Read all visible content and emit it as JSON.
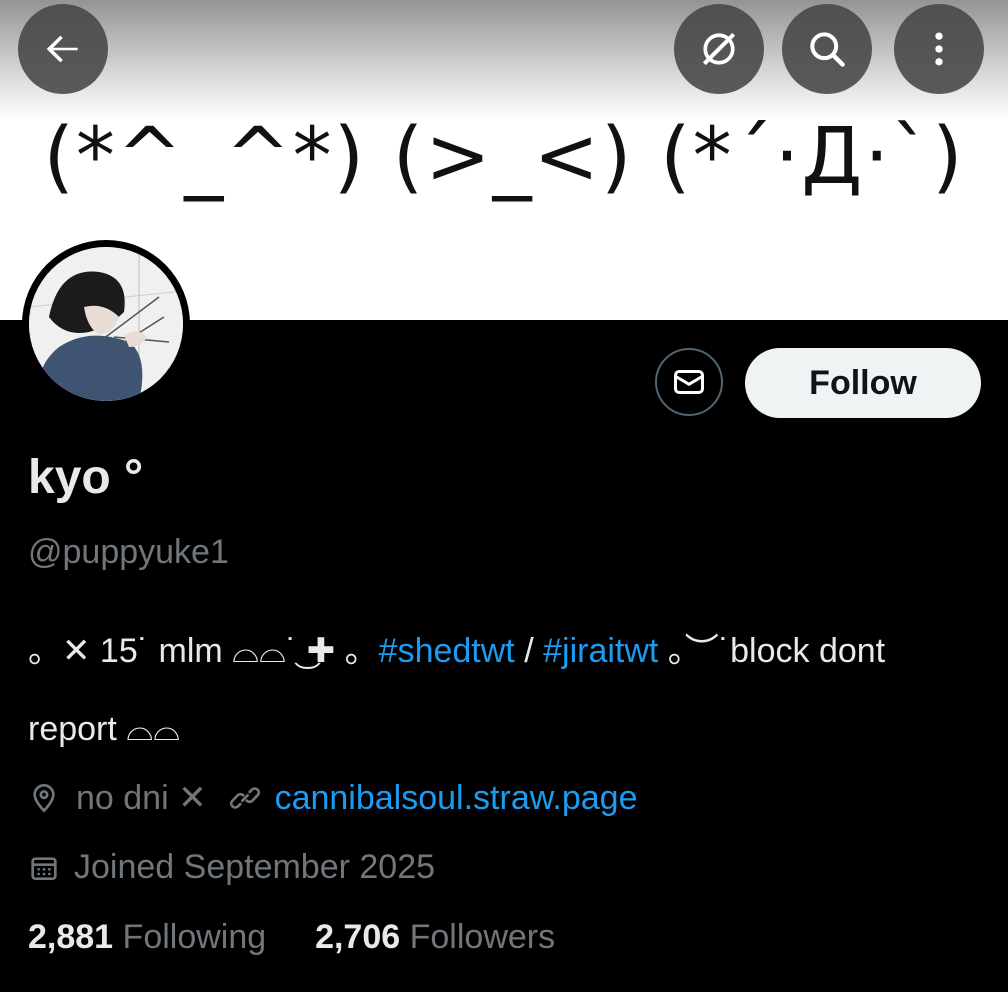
{
  "banner": {
    "text": "(*^_^*) (>_<) (*´·Д·`)"
  },
  "top_bar": {
    "back_icon": "arrow-left-icon",
    "grok_icon": "grok-icon",
    "search_icon": "search-icon",
    "more_icon": "more-vertical-icon"
  },
  "profile": {
    "display_name": "kyo °",
    "handle": "@puppyuke1",
    "follow_label": "Follow",
    "bio": {
      "part1": "。✕ 15˙ mlm ⌓⌓˙͜ ✚ 。",
      "hashtag1": "#shedtwt",
      "sep": " / ",
      "hashtag2": "#jiraitwt",
      "part2": " 。︶˙block dont report ⌓⌓"
    },
    "location": "no dni ✕",
    "website": "cannibalsoul.straw.page",
    "joined": "Joined September 2025"
  },
  "stats": {
    "following_count": "2,881",
    "following_label": "Following",
    "followers_count": "2,706",
    "followers_label": "Followers"
  },
  "colors": {
    "accent": "#1d9bf0",
    "background": "#000000",
    "muted": "#71767b"
  }
}
